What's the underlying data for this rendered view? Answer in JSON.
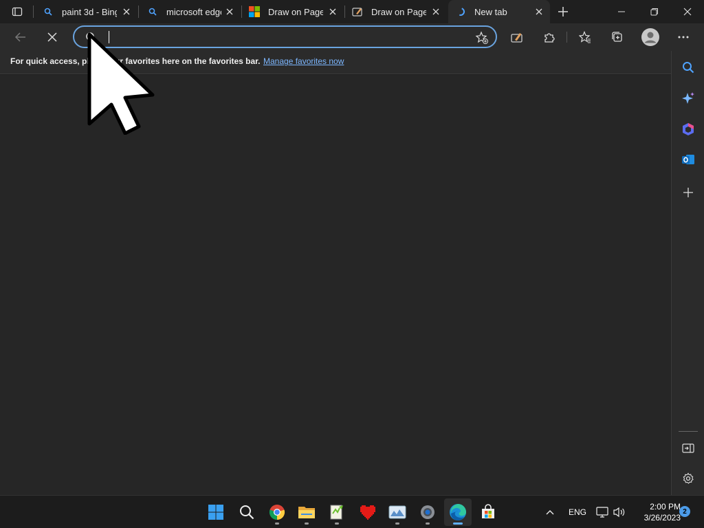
{
  "tabs": [
    {
      "title": "paint 3d - Bing",
      "icon": "search-icon"
    },
    {
      "title": "microsoft edge",
      "icon": "search-icon"
    },
    {
      "title": "Draw on Page",
      "icon": "microsoft-logo-icon"
    },
    {
      "title": "Draw on Page",
      "icon": "draw-icon"
    },
    {
      "title": "New tab",
      "icon": "loading-icon"
    }
  ],
  "address_bar": {
    "value": "",
    "placeholder": ""
  },
  "favorites_bar": {
    "message": "For quick access, place your favorites here on the favorites bar.",
    "link": "Manage favorites now"
  },
  "taskbar": {
    "language": "ENG",
    "time": "2:00 PM",
    "date": "3/26/2023",
    "notification_count": "2",
    "apps": [
      "start",
      "search",
      "chrome",
      "file-explorer",
      "notepad-plus",
      "heart-app",
      "photos",
      "settings",
      "edge",
      "store"
    ]
  },
  "colors": {
    "accent": "#6aa4e0",
    "link": "#7db7ff",
    "background": "#262626"
  }
}
